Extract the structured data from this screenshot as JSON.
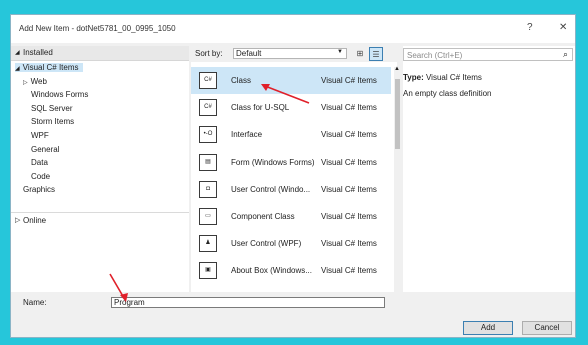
{
  "window": {
    "title": "Add New Item - dotNet5781_00_0995_1050",
    "help_label": "?",
    "close_label": "✕"
  },
  "left": {
    "installed": "Installed",
    "tree": [
      {
        "label": "Visual C# Items",
        "indent": 0,
        "glyph": "◢",
        "selected": true
      },
      {
        "label": "Web",
        "indent": 1,
        "glyph": "▷"
      },
      {
        "label": "Windows Forms",
        "indent": 2
      },
      {
        "label": "SQL Server",
        "indent": 2
      },
      {
        "label": "Storm Items",
        "indent": 2
      },
      {
        "label": "WPF",
        "indent": 2
      },
      {
        "label": "General",
        "indent": 2
      },
      {
        "label": "Data",
        "indent": 2
      },
      {
        "label": "Code",
        "indent": 2
      },
      {
        "label": "Graphics",
        "indent": 1
      }
    ],
    "online": "Online"
  },
  "middle": {
    "sort_label": "Sort by:",
    "sort_value": "Default",
    "items": [
      {
        "name": "Class",
        "type": "Visual C# Items",
        "icon": "class-icon",
        "glyph": "C#",
        "selected": true
      },
      {
        "name": "Class for U-SQL",
        "type": "Visual C# Items",
        "icon": "class-usql-icon",
        "glyph": "C#"
      },
      {
        "name": "Interface",
        "type": "Visual C# Items",
        "icon": "interface-icon",
        "glyph": "•-O"
      },
      {
        "name": "Form (Windows Forms)",
        "type": "Visual C# Items",
        "icon": "form-icon",
        "glyph": "▤"
      },
      {
        "name": "User Control (Windo...",
        "type": "Visual C# Items",
        "icon": "user-control-icon",
        "glyph": "◘"
      },
      {
        "name": "Component Class",
        "type": "Visual C# Items",
        "icon": "component-icon",
        "glyph": "▭"
      },
      {
        "name": "User Control (WPF)",
        "type": "Visual C# Items",
        "icon": "wpf-control-icon",
        "glyph": "♟"
      },
      {
        "name": "About Box (Windows...",
        "type": "Visual C# Items",
        "icon": "about-box-icon",
        "glyph": "▣"
      }
    ]
  },
  "right": {
    "search_placeholder": "Search (Ctrl+E)",
    "type_label": "Type:",
    "type_value": "Visual C# Items",
    "description": "An empty class definition"
  },
  "bottom": {
    "name_label": "Name:",
    "name_value": "Program",
    "add_label": "Add",
    "cancel_label": "Cancel"
  },
  "colors": {
    "desktop": "#26c6da",
    "selection": "#cde6f7",
    "annotation_arrow": "#e0202a"
  }
}
